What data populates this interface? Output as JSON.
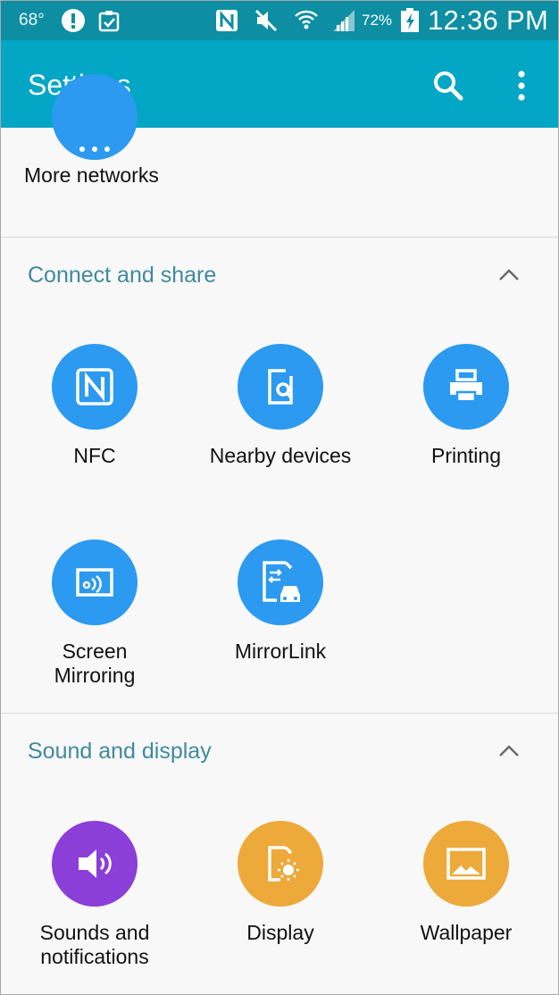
{
  "status_bar": {
    "temperature": "68°",
    "battery_percent": "72%",
    "time": "12:36 PM",
    "icons": [
      "alert-icon",
      "clipboard-check-icon",
      "nfc-status-icon",
      "mute-icon",
      "wifi-icon",
      "signal-icon",
      "battery-charging-icon"
    ]
  },
  "app_bar": {
    "title": "Settings",
    "actions": [
      "search-icon",
      "more-options-icon"
    ]
  },
  "partial_item": {
    "label": "More networks",
    "icon": "more-networks-icon"
  },
  "sections": {
    "connect": {
      "title": "Connect and share",
      "items": [
        {
          "label": "NFC",
          "icon": "nfc-icon"
        },
        {
          "label": "Nearby devices",
          "icon": "nearby-devices-icon"
        },
        {
          "label": "Printing",
          "icon": "printer-icon"
        },
        {
          "label": "Screen\nMirroring",
          "icon": "screen-mirroring-icon"
        },
        {
          "label": "MirrorLink",
          "icon": "mirrorlink-icon"
        }
      ]
    },
    "sound": {
      "title": "Sound and display",
      "items": [
        {
          "label": "Sounds and\nnotifications",
          "icon": "speaker-icon"
        },
        {
          "label": "Display",
          "icon": "display-icon"
        },
        {
          "label": "Wallpaper",
          "icon": "wallpaper-icon"
        }
      ]
    }
  },
  "colors": {
    "status_bar": "#0e8ea3",
    "app_bar": "#03a6c4",
    "section_title": "#3e8aa0",
    "icon_blue": "#2b9af0",
    "icon_purple": "#8b3ed8",
    "icon_orange": "#eda93a"
  }
}
